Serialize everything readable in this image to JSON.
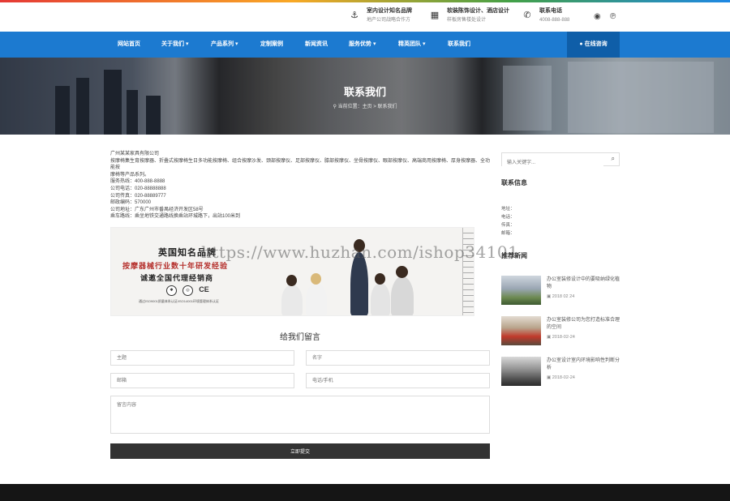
{
  "topbar": {
    "items": [
      {
        "icon": "anchor-icon",
        "title": "室内设计知名品牌",
        "sub": "地产公司战略合作方"
      },
      {
        "icon": "building-icon",
        "title": "软装陈饰设计、酒店设计",
        "sub": "样板房售楼处设计"
      },
      {
        "icon": "phone-icon",
        "title": "联系电话",
        "sub": "4008-888-888"
      }
    ],
    "social": [
      "weibo-icon",
      "pinterest-icon"
    ]
  },
  "nav": {
    "items": [
      "网站首页",
      "关于我们",
      "产品系列",
      "定制案例",
      "新闻资讯",
      "服务优势",
      "精英团队",
      "联系我们"
    ],
    "consult": "在线咨询"
  },
  "banner": {
    "title": "联系我们",
    "crumb_prefix": "当前位置：",
    "crumb_home": "主页",
    "crumb_sep": ">",
    "crumb_current": "联系我们"
  },
  "contact": {
    "lines": [
      "广州某某家具有限公司",
      "按摩椅集生育按摩器、折叠式按摩椅生日多功能按摩椅、组合按摩沙发、颈部按摩仪、足部按摩仪、膝部按摩仪、坐骨按摩仪、眼部按摩仪、高端商用按摩椅、厚身按摩器、全功能按",
      "摩椅等产品系列。",
      "服务热线：400-888-8888",
      "公司电话：020-88888888",
      "公司传真：020-88889777",
      "邮政编码：570000",
      "公司地址：广东广州市番禺经济开发区58号",
      "乘车路线：乘坐地铁交通路线换乘站环城路下，出站100米到"
    ]
  },
  "ad": {
    "brand": "英国知名品牌",
    "slogan": "按摩器械行业数十年研发经验",
    "invite": "诚邀全国代理经销商",
    "cert": "通过ISO9001质量体系认证/ISO14001环境管理体系认证",
    "badges": [
      "CE"
    ]
  },
  "watermark": "https://www.huzhan.com/ishop34101",
  "form": {
    "title": "给我们留言",
    "subject": "主题",
    "name": "名字",
    "email": "邮箱",
    "phone": "电话/手机",
    "message": "留言内容",
    "submit": "立即提交"
  },
  "sidebar": {
    "search_placeholder": "输入关键字...",
    "contact_title": "联系信息",
    "contact_lines": [
      "地址：",
      "电话：",
      "传真：",
      "邮箱："
    ],
    "news_title": "推荐新闻",
    "news": [
      {
        "title": "办公室装修设计中的要吸纳绿化植物",
        "date": "2018 02 24"
      },
      {
        "title": "办公室装修公司为您打造标准合理的空间",
        "date": "2018-02-24"
      },
      {
        "title": "办公室设计室内环境影响性判断分析",
        "date": "2018-02-24"
      }
    ]
  },
  "colors": {
    "nav": "#1c7ad0",
    "nav_active": "#0f5ea8",
    "submit": "#333333",
    "footer": "#151515"
  }
}
